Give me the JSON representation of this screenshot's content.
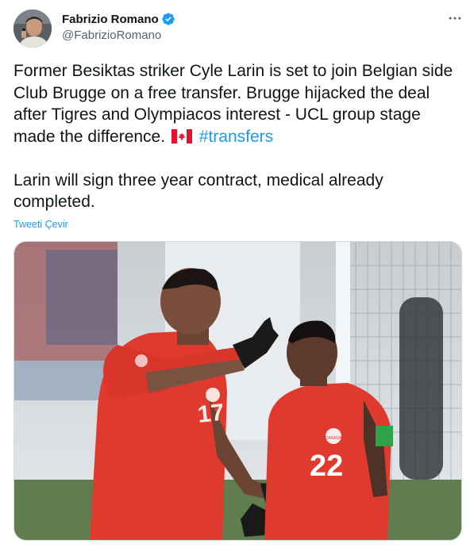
{
  "author": {
    "display_name": "Fabrizio Romano",
    "handle": "@FabrizioRomano",
    "verified": true
  },
  "tweet": {
    "paragraph1": "Former Besiktas striker Cyle Larin is set to join Belgian side Club Brugge on a free transfer. Brugge hijacked the deal after Tigres and Olympiacos interest - UCL group stage made the difference.",
    "hashtag": "#transfers",
    "paragraph2": "Larin will sign three year contract, medical already completed.",
    "translate_label": "Tweeti Çevir"
  },
  "media": {
    "jersey_numbers": {
      "left": "17",
      "right": "22"
    },
    "badge_text": "CANADA"
  },
  "icons": {
    "more": "more-horizontal-icon",
    "verified": "verified-badge-icon",
    "flag": "canada-flag-icon"
  },
  "colors": {
    "link": "#1d9bf0",
    "text": "#0f1419",
    "secondary": "#536471",
    "jersey": "#e03a2f"
  }
}
